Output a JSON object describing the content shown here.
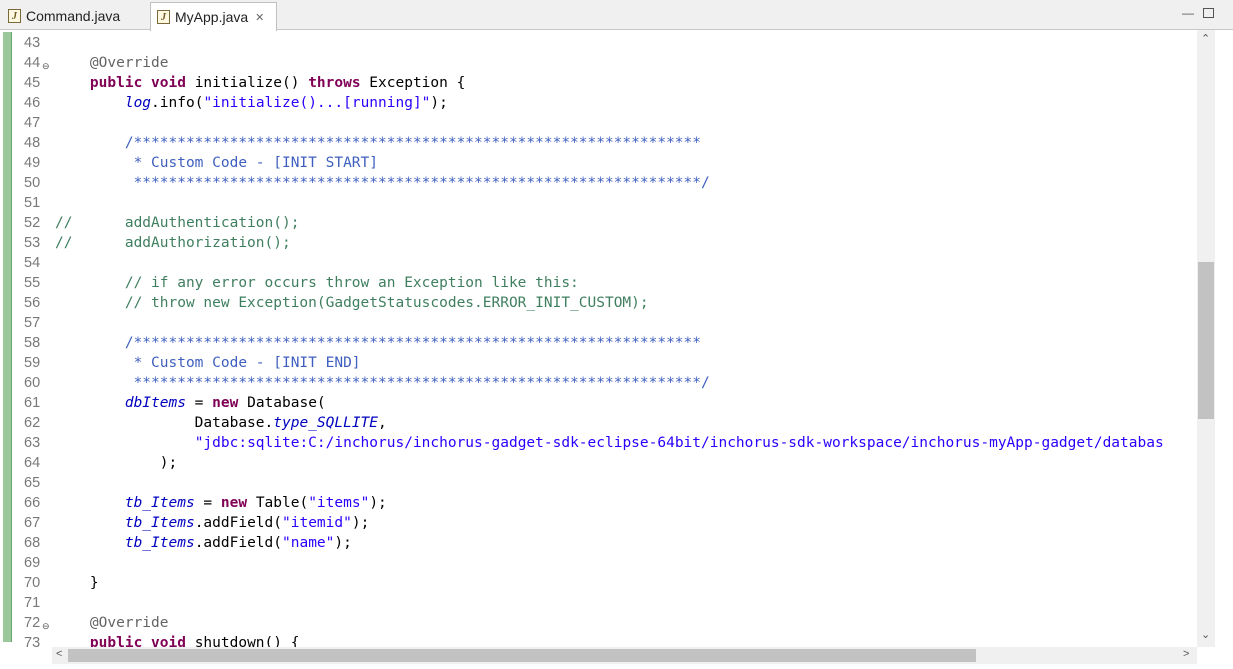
{
  "tabs": [
    {
      "label": "Command.java",
      "active": false
    },
    {
      "label": "MyApp.java",
      "active": true,
      "close": "✕"
    }
  ],
  "lines": [
    {
      "n": "43",
      "parts": []
    },
    {
      "n": "44",
      "fold": true,
      "parts": [
        [
          "ann",
          "    @Override"
        ]
      ]
    },
    {
      "n": "45",
      "parts": [
        [
          "",
          "    "
        ],
        [
          "kw",
          "public"
        ],
        [
          "",
          " "
        ],
        [
          "kw",
          "void"
        ],
        [
          "",
          " initialize() "
        ],
        [
          "kw",
          "throws"
        ],
        [
          "",
          " Exception {"
        ]
      ]
    },
    {
      "n": "46",
      "parts": [
        [
          "",
          "        "
        ],
        [
          "fld",
          "log"
        ],
        [
          "",
          ".info("
        ],
        [
          "str",
          "\"initialize()...[running]\""
        ],
        [
          "",
          ");"
        ]
      ]
    },
    {
      "n": "47",
      "parts": []
    },
    {
      "n": "48",
      "parts": [
        [
          "jd",
          "        /*****************************************************************"
        ]
      ]
    },
    {
      "n": "49",
      "parts": [
        [
          "jd",
          "         * Custom Code - [INIT START]"
        ]
      ]
    },
    {
      "n": "50",
      "parts": [
        [
          "jd",
          "         *****************************************************************/"
        ]
      ]
    },
    {
      "n": "51",
      "parts": []
    },
    {
      "n": "52",
      "parts": [
        [
          "cmt",
          "//      addAuthentication();"
        ]
      ]
    },
    {
      "n": "53",
      "parts": [
        [
          "cmt",
          "//      addAuthorization();"
        ]
      ]
    },
    {
      "n": "54",
      "parts": []
    },
    {
      "n": "55",
      "parts": [
        [
          "cmt",
          "        // if any error occurs throw an Exception like this:"
        ]
      ]
    },
    {
      "n": "56",
      "parts": [
        [
          "cmt",
          "        // throw new Exception(GadgetStatuscodes.ERROR_INIT_CUSTOM);"
        ]
      ]
    },
    {
      "n": "57",
      "parts": []
    },
    {
      "n": "58",
      "parts": [
        [
          "jd",
          "        /*****************************************************************"
        ]
      ]
    },
    {
      "n": "59",
      "parts": [
        [
          "jd",
          "         * Custom Code - [INIT END]"
        ]
      ]
    },
    {
      "n": "60",
      "parts": [
        [
          "jd",
          "         *****************************************************************/"
        ]
      ]
    },
    {
      "n": "61",
      "parts": [
        [
          "",
          "        "
        ],
        [
          "fld",
          "dbItems"
        ],
        [
          "",
          " = "
        ],
        [
          "kw",
          "new"
        ],
        [
          "",
          " Database("
        ]
      ]
    },
    {
      "n": "62",
      "parts": [
        [
          "",
          "                Database."
        ],
        [
          "fld",
          "type_SQLLITE"
        ],
        [
          "",
          ","
        ]
      ]
    },
    {
      "n": "63",
      "parts": [
        [
          "",
          "                "
        ],
        [
          "str",
          "\"jdbc:sqlite:C:/inchorus/inchorus-gadget-sdk-eclipse-64bit/inchorus-sdk-workspace/inchorus-myApp-gadget/databas"
        ]
      ]
    },
    {
      "n": "64",
      "parts": [
        [
          "",
          "            );"
        ]
      ]
    },
    {
      "n": "65",
      "parts": []
    },
    {
      "n": "66",
      "parts": [
        [
          "",
          "        "
        ],
        [
          "fld",
          "tb_Items"
        ],
        [
          "",
          " = "
        ],
        [
          "kw",
          "new"
        ],
        [
          "",
          " Table("
        ],
        [
          "str",
          "\"items\""
        ],
        [
          "",
          ");"
        ]
      ]
    },
    {
      "n": "67",
      "parts": [
        [
          "",
          "        "
        ],
        [
          "fld",
          "tb_Items"
        ],
        [
          "",
          ".addField("
        ],
        [
          "str",
          "\"itemid\""
        ],
        [
          "",
          ");"
        ]
      ]
    },
    {
      "n": "68",
      "parts": [
        [
          "",
          "        "
        ],
        [
          "fld",
          "tb_Items"
        ],
        [
          "",
          ".addField("
        ],
        [
          "str",
          "\"name\""
        ],
        [
          "",
          ");"
        ]
      ]
    },
    {
      "n": "69",
      "parts": []
    },
    {
      "n": "70",
      "parts": [
        [
          "",
          "    }"
        ]
      ]
    },
    {
      "n": "71",
      "parts": []
    },
    {
      "n": "72",
      "fold": true,
      "parts": [
        [
          "ann",
          "    @Override"
        ]
      ]
    },
    {
      "n": "73",
      "parts": [
        [
          "",
          "    "
        ],
        [
          "kw",
          "public"
        ],
        [
          "",
          " "
        ],
        [
          "kw",
          "void"
        ],
        [
          "",
          " shutdown() {"
        ]
      ]
    }
  ],
  "scroll": {
    "up": "⌃",
    "down": "⌄",
    "left": "<",
    "right": ">"
  },
  "window": {
    "minimize": "—"
  }
}
